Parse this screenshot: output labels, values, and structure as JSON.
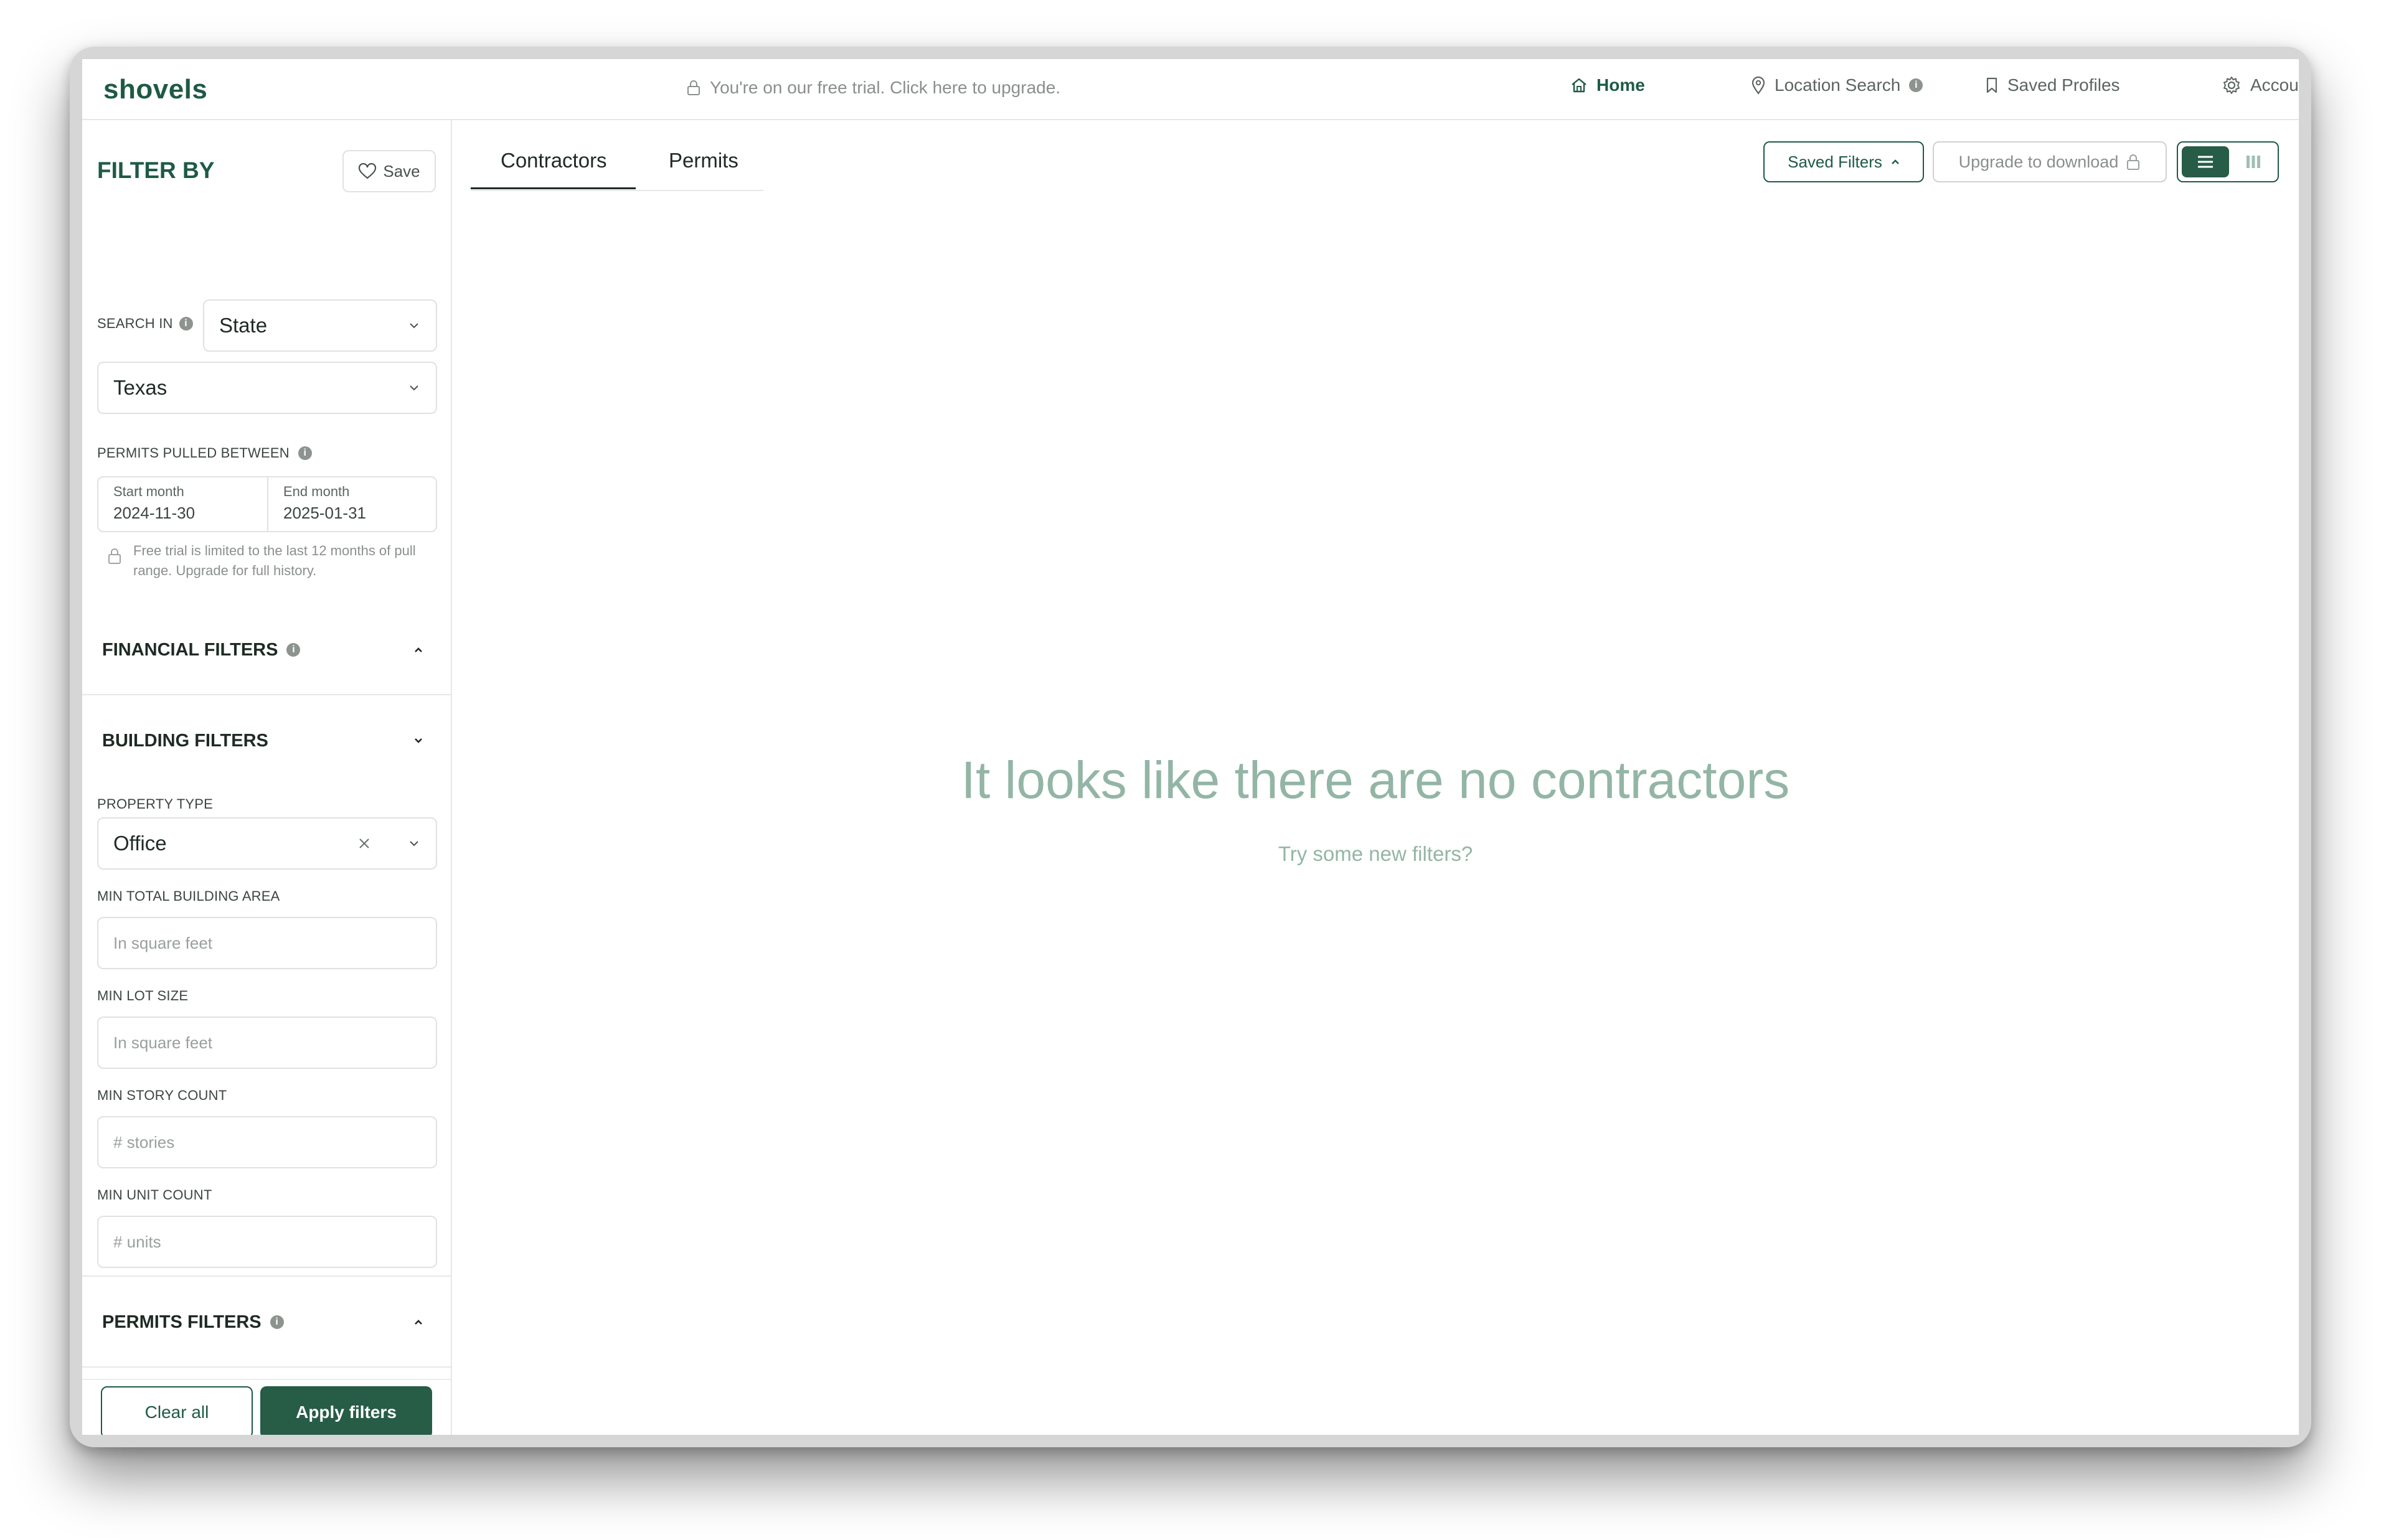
{
  "header": {
    "logo": "shovels",
    "trial_banner": "You're on our free trial. Click here to upgrade.",
    "nav": [
      {
        "label": "Home",
        "icon": "home-icon"
      },
      {
        "label": "Location Search",
        "icon": "pin-icon"
      },
      {
        "label": "Saved Profiles",
        "icon": "bookmark-icon"
      },
      {
        "label": "Account",
        "icon": "gear-icon"
      }
    ]
  },
  "sidebar": {
    "title": "FILTER BY",
    "save_label": "Save",
    "search_in_label": "SEARCH IN",
    "search_in_value": "State",
    "state_value": "Texas",
    "permits_between_label": "PERMITS PULLED BETWEEN",
    "start_label": "Start month",
    "start_value": "2024-11-30",
    "end_label": "End month",
    "end_value": "2025-01-31",
    "trial_note": "Free trial is limited to the last 12 months of pull range. Upgrade for full history.",
    "financial_filters": "FINANCIAL FILTERS",
    "building_filters": "BUILDING FILTERS",
    "property_type_label": "PROPERTY TYPE",
    "property_type_value": "Office",
    "min_total_area_label": "MIN TOTAL BUILDING AREA",
    "min_total_area_placeholder": "In square feet",
    "min_lot_size_label": "MIN LOT SIZE",
    "min_lot_size_placeholder": "In square feet",
    "min_story_label": "MIN STORY COUNT",
    "min_story_placeholder": "# stories",
    "min_unit_label": "MIN UNIT COUNT",
    "min_unit_placeholder": "# units",
    "permits_filters": "PERMITS FILTERS",
    "clear_label": "Clear all",
    "apply_label": "Apply filters"
  },
  "main": {
    "tabs": [
      {
        "label": "Contractors"
      },
      {
        "label": "Permits"
      }
    ],
    "saved_filters_label": "Saved Filters",
    "upgrade_label": "Upgrade to download",
    "empty_title": "It looks like there are no contractors",
    "empty_subtitle": "Try some new filters?"
  },
  "colors": {
    "brand": "#1e5a44",
    "brand_button": "#275c47",
    "empty_text": "#93b5a6"
  }
}
